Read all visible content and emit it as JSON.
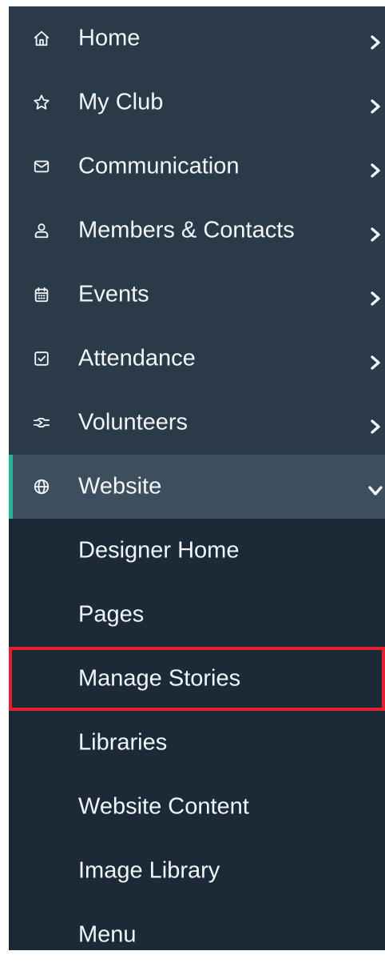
{
  "sidebar": {
    "items": [
      {
        "label": "Home",
        "icon": "home-icon",
        "expanded": false
      },
      {
        "label": "My Club",
        "icon": "star-icon",
        "expanded": false
      },
      {
        "label": "Communication",
        "icon": "envelope-icon",
        "expanded": false
      },
      {
        "label": "Members & Contacts",
        "icon": "user-icon",
        "expanded": false
      },
      {
        "label": "Events",
        "icon": "calendar-icon",
        "expanded": false
      },
      {
        "label": "Attendance",
        "icon": "checkbox-icon",
        "expanded": false
      },
      {
        "label": "Volunteers",
        "icon": "handshake-icon",
        "expanded": false
      },
      {
        "label": "Website",
        "icon": "globe-icon",
        "expanded": true
      }
    ],
    "website_submenu": [
      {
        "label": "Designer Home"
      },
      {
        "label": "Pages"
      },
      {
        "label": "Manage Stories",
        "highlighted": true
      },
      {
        "label": "Libraries"
      },
      {
        "label": "Website Content"
      },
      {
        "label": "Image Library"
      },
      {
        "label": "Menu"
      }
    ]
  },
  "colors": {
    "sidebar_bg": "#2b3a48",
    "submenu_bg": "#1c2a37",
    "active_bg": "#3d4f5f",
    "active_accent": "#27b39a",
    "highlight_outline": "#e3202c",
    "text": "#f2f5f7"
  }
}
